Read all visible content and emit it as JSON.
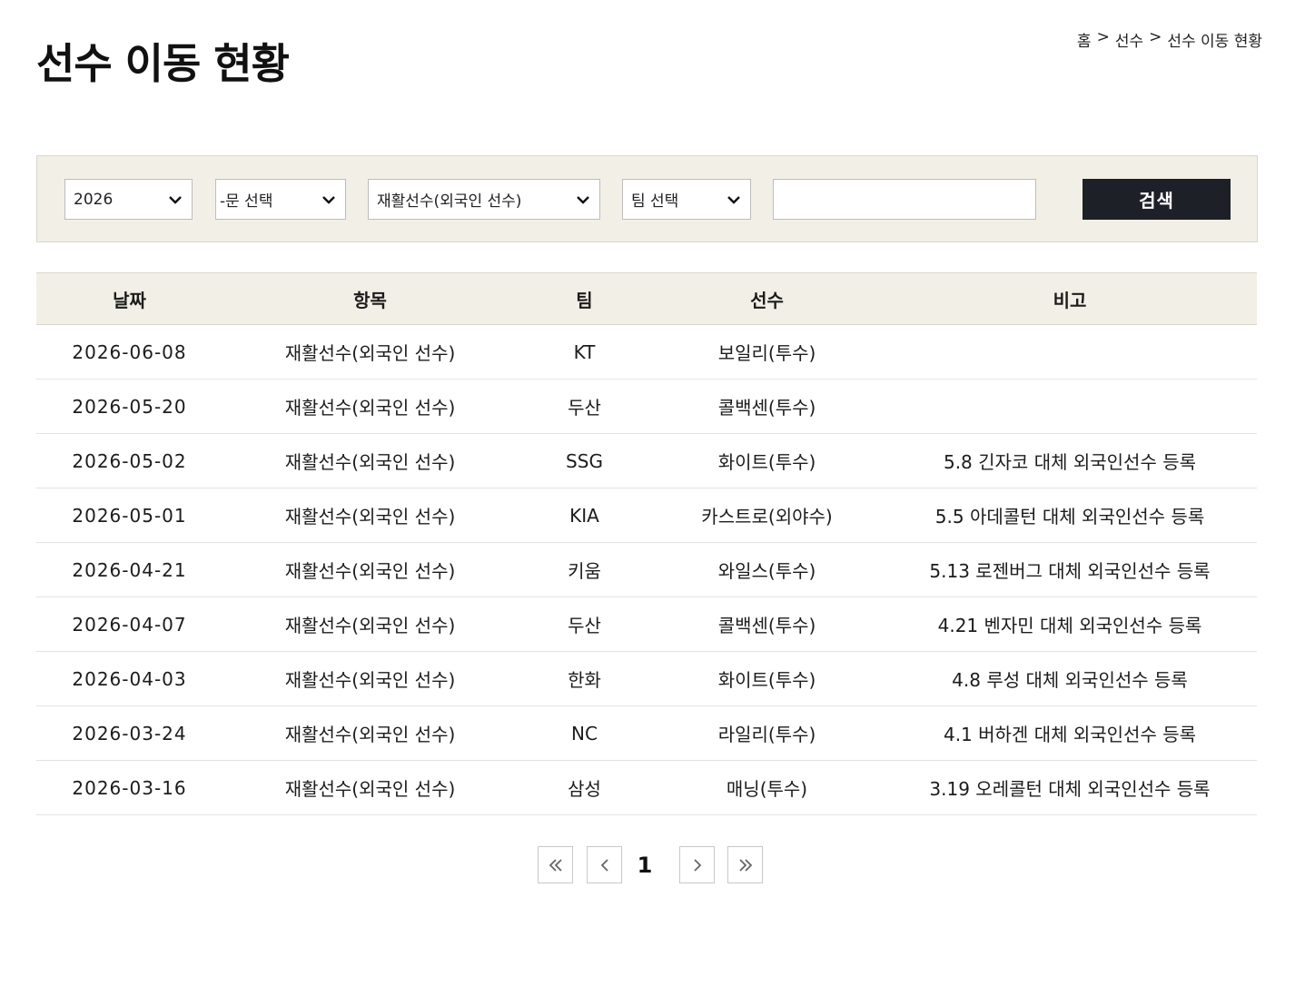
{
  "header": {
    "title": "선수 이동 현황",
    "breadcrumb": [
      "홈",
      ">",
      "선수",
      ">",
      "선수 이동 현황"
    ]
  },
  "filters": {
    "year": "2026",
    "division": "-문 선택",
    "category": "재활선수(외국인 선수)",
    "team": "팀 선택",
    "search_value": "",
    "search_button": "검색"
  },
  "table": {
    "columns": [
      "날짜",
      "항목",
      "팀",
      "선수",
      "비고"
    ],
    "rows": [
      [
        "2026-06-08",
        "재활선수(외국인 선수)",
        "KT",
        "보일리(투수)",
        ""
      ],
      [
        "2026-05-20",
        "재활선수(외국인 선수)",
        "두산",
        "콜백센(투수)",
        ""
      ],
      [
        "2026-05-02",
        "재활선수(외국인 선수)",
        "SSG",
        "화이트(투수)",
        "5.8 긴자코 대체 외국인선수 등록"
      ],
      [
        "2026-05-01",
        "재활선수(외국인 선수)",
        "KIA",
        "카스트로(외야수)",
        "5.5 아데콜턴 대체 외국인선수 등록"
      ],
      [
        "2026-04-21",
        "재활선수(외국인 선수)",
        "키움",
        "와일스(투수)",
        "5.13 로젠버그 대체 외국인선수 등록"
      ],
      [
        "2026-04-07",
        "재활선수(외국인 선수)",
        "두산",
        "콜백센(투수)",
        "4.21 벤자민 대체 외국인선수 등록"
      ],
      [
        "2026-04-03",
        "재활선수(외국인 선수)",
        "한화",
        "화이트(투수)",
        "4.8 루성 대체 외국인선수 등록"
      ],
      [
        "2026-03-24",
        "재활선수(외국인 선수)",
        "NC",
        "라일리(투수)",
        "4.1 버하겐 대체 외국인선수 등록"
      ],
      [
        "2026-03-16",
        "재활선수(외국인 선수)",
        "삼성",
        "매닝(투수)",
        "3.19 오레콜턴 대체 외국인선수 등록"
      ]
    ]
  },
  "pagination": {
    "current": "1",
    "icons": [
      "double-chevron-left-icon",
      "chevron-left-icon",
      "chevron-right-icon",
      "double-chevron-right-icon"
    ]
  }
}
